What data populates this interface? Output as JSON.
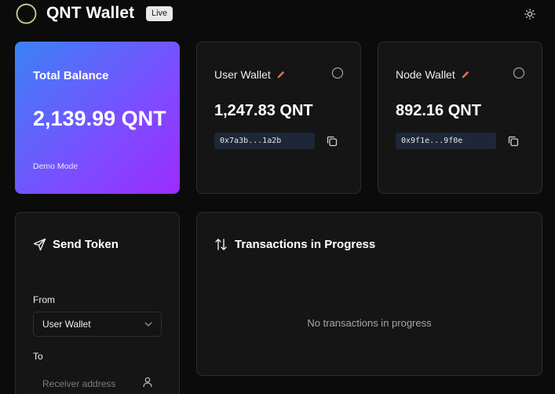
{
  "header": {
    "title": "QNT Wallet",
    "badge": "Live",
    "logo_icon": "ring-logo-icon",
    "theme_icon": "sun-icon"
  },
  "total": {
    "label": "Total Balance",
    "value": "2,139.99 QNT",
    "mode": "Demo Mode"
  },
  "wallets": [
    {
      "name": "User Wallet",
      "balance": "1,247.83 QNT",
      "address": "0x7a3b...1a2b"
    },
    {
      "name": "Node Wallet",
      "balance": "892.16 QNT",
      "address": "0x9f1e...9f0e"
    }
  ],
  "send": {
    "title": "Send Token",
    "from_label": "From",
    "from_value": "User Wallet",
    "to_label": "To",
    "to_placeholder": "Receiver address"
  },
  "transactions": {
    "title": "Transactions in Progress",
    "empty_text": "No transactions in progress"
  },
  "colors": {
    "background": "#0b0b0b",
    "card": "#151515",
    "gradient_start": "#3b82f6",
    "gradient_end": "#9b2cff",
    "edit_icon": "#d9744a",
    "address_bg": "#1d2738"
  }
}
